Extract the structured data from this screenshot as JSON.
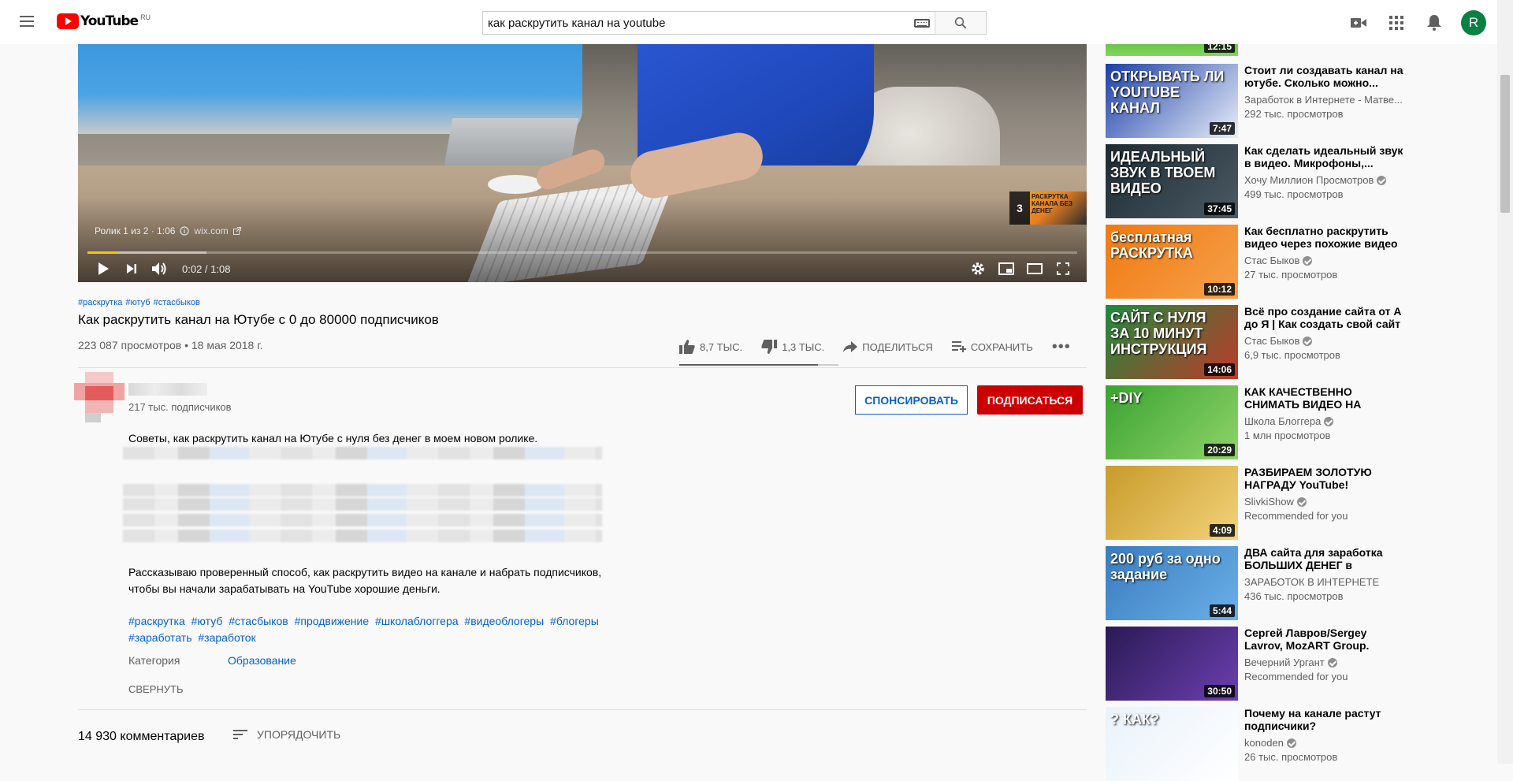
{
  "header": {
    "logo_text": "YouTube",
    "region": "RU",
    "search_value": "как раскрутить канал на youtube",
    "avatar_letter": "R"
  },
  "player": {
    "info_playlist": "Ролик 1 из 2 · 1:06",
    "info_link": "wix.com",
    "endcard_count": "3",
    "endcard_text": "РАСКРУТКА КАНАЛА БЕЗ ДЕНЕГ",
    "time": "0:02 / 1:08",
    "progress_fraction": 0.031,
    "loaded_fraction": 0.12
  },
  "video": {
    "tags": [
      "#раскрутка",
      "#ютуб",
      "#стасбыков"
    ],
    "title": "Как раскрутить канал на Ютубе с 0 до 80000 подписчиков",
    "views": "223 087 просмотров • 18 мая 2018 г.",
    "likes": "8,7 ТЫС.",
    "dislikes": "1,3 ТЫС.",
    "like_fraction": 0.87,
    "share_label": "ПОДЕЛИТЬСЯ",
    "save_label": "СОХРАНИТЬ"
  },
  "channel": {
    "subscribers": "217 тыс. подписчиков",
    "sponsor_label": "СПОНСИРОВАТЬ",
    "subscribe_label": "ПОДПИСАТЬСЯ"
  },
  "description": {
    "line1": "Советы, как раскрутить канал на Ютубе с нуля без денег в моем новом ролике.",
    "para2_line1": "Рассказываю проверенный способ, как раскрутить видео на канале и набрать подписчиков,",
    "para2_line2": "чтобы вы начали зарабатывать на YouTube хорошие деньги.",
    "hashtags": [
      "#раскрутка",
      "#ютуб",
      "#стасбыков",
      "#продвижение",
      "#школаблоггера",
      "#видеоблогеры",
      "#блогеры",
      "#заработать",
      "#заработок"
    ],
    "category_label": "Категория",
    "category_value": "Образование",
    "collapse_label": "СВЕРНУТЬ"
  },
  "comments": {
    "count": "14 930 комментариев",
    "sort_label": "УПОРЯДОЧИТЬ"
  },
  "sidebar": {
    "top_stub_duration": "12:15",
    "items": [
      {
        "title": "Стоит ли создавать канал на ютубе. Сколько можно...",
        "channel": "Заработок в Интернете - Матве...",
        "meta": "292 тыс. просмотров",
        "duration": "7:47",
        "thumb_text": "ОТКРЫВАТЬ ЛИ YOUTUBE КАНАЛ",
        "verified": false,
        "color_a": "#1b3fa8",
        "color_b": "#e8eef8"
      },
      {
        "title": "Как сделать идеальный звук в видео. Микрофоны,...",
        "channel": "Хочу Миллион Просмотров",
        "meta": "499 тыс. просмотров",
        "duration": "37:45",
        "thumb_text": "ИДЕАЛЬНЫЙ ЗВУК В ТВОЕМ ВИДЕО",
        "verified": true,
        "color_a": "#1d2a33",
        "color_b": "#4b5a63"
      },
      {
        "title": "Как бесплатно раскрутить видео через похожие видео ...",
        "channel": "Стас Быков",
        "meta": "27 тыс. просмотров",
        "duration": "10:12",
        "thumb_text": "бесплатная РАСКРУТКА",
        "verified": true,
        "color_a": "#f07a10",
        "color_b": "#f6a04b"
      },
      {
        "title": "Всё про создание сайта от А до Я | Как создать свой сайт ...",
        "channel": "Стас Быков",
        "meta": "6,9 тыс. просмотров",
        "duration": "14:06",
        "thumb_text": "САЙТ С НУЛЯ ЗА 10 МИНУТ ИНСТРУКЦИЯ",
        "verified": true,
        "color_a": "#1e8a3c",
        "color_b": "#c0392b"
      },
      {
        "title": "КАК КАЧЕСТВЕННО СНИМАТЬ ВИДЕО НА ТЕЛЕФОН",
        "channel": "Школа Блоггера",
        "meta": "1 млн просмотров",
        "duration": "20:29",
        "thumb_text": "+DIY",
        "verified": true,
        "color_a": "#3aa32f",
        "color_b": "#8fd46b"
      },
      {
        "title": "РАЗБИРАЕМ ЗОЛОТУЮ НАГРАДУ YouTube!",
        "channel": "SlivkiShow",
        "meta": "Recommended for you",
        "duration": "4:09",
        "thumb_text": "",
        "verified": true,
        "color_a": "#c89b2a",
        "color_b": "#f3d27a"
      },
      {
        "title": "ДВА сайта для заработка БОЛЬШИХ ДЕНЕГ в интернет...",
        "channel": "ЗАРАБОТОК В ИНТЕРНЕТЕ",
        "meta": "436 тыс. просмотров",
        "duration": "5:44",
        "thumb_text": "200 руб за одно задание",
        "verified": false,
        "color_a": "#3a7bbf",
        "color_b": "#6ab0e8"
      },
      {
        "title": "Сергей Лавров/Sergey Lavrov, MozART Group. Вечерний...",
        "channel": "Вечерний Ургант",
        "meta": "Recommended for you",
        "duration": "30:50",
        "thumb_text": "",
        "verified": true,
        "color_a": "#2a1a55",
        "color_b": "#6c3fb0"
      },
      {
        "title": "Почему на канале растут подписчики? Непрерывный...",
        "channel": "konoden",
        "meta": "26 тыс. просмотров",
        "duration": "",
        "thumb_text": "? КАК?",
        "verified": true,
        "color_a": "#e9f2fb",
        "color_b": "#ffffff"
      }
    ]
  }
}
